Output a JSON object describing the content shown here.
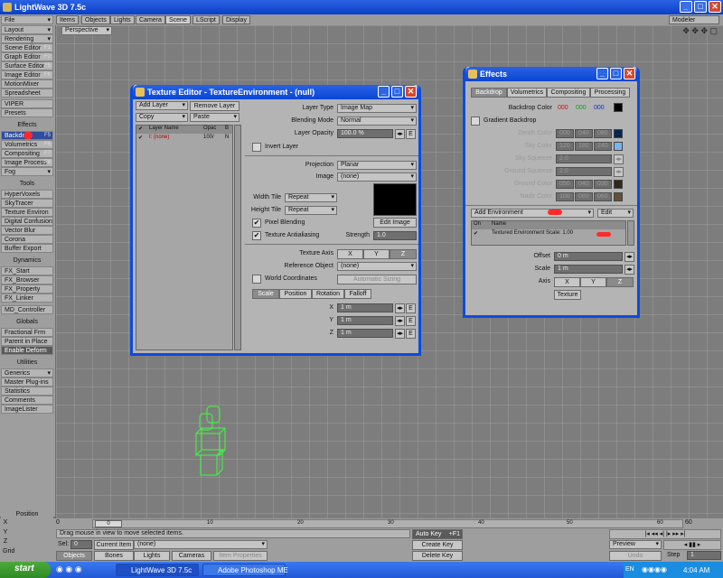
{
  "app": {
    "title": "LightWave 3D 7.5c"
  },
  "top_tabs": [
    "Items",
    "Objects",
    "Lights",
    "Camera",
    "Scene",
    "LScript",
    "Display"
  ],
  "modeler_label": "Modeler",
  "view_mode": "Perspective",
  "sidebar": {
    "file": "File",
    "layout": "Layout",
    "rendering": "Rendering",
    "scene_editor": "Scene Editor",
    "scene_editor_key": "F1",
    "graph_editor": "Graph Editor",
    "graph_editor_key": "F2",
    "surface_editor": "Surface Editor",
    "surface_editor_key": "F5",
    "image_editor": "Image Editor",
    "image_editor_key": "F6",
    "motion_mixer": "MotionMixer",
    "spreadsheet": "Spreadsheet",
    "viper": "VIPER",
    "presets": "Presets",
    "effects_header": "Effects",
    "backdrop": "Backdrop",
    "backdrop_key": "F5",
    "volumetrics": "Volumetrics",
    "volumetrics_key": "F6",
    "compositing": "Compositing",
    "compositing_key": "F7",
    "image_process": "Image Process",
    "image_process_key": "F8",
    "fog": "Fog",
    "tools_header": "Tools",
    "tools": [
      "HyperVoxels",
      "SkyTracer",
      "Texture Environ",
      "Digital Confusion",
      "Vector Blur",
      "Corona",
      "Buffer Export"
    ],
    "dynamics_header": "Dynamics",
    "dynamics": [
      "FX_Start",
      "FX_Browser",
      "FX_Property",
      "FX_Linker"
    ],
    "md_controller": "MD_Controller",
    "globals_header": "Globals",
    "globals": [
      "Fractional Frm",
      "Parent in Place",
      "Enable Deform"
    ],
    "utilities_header": "Utilities",
    "generics": "Generics",
    "master_plugins": "Master Plug-ins",
    "statistics": "Statistics",
    "comments": "Comments",
    "imagelister": "ImageLister",
    "position": "Position"
  },
  "texture_editor": {
    "title": "Texture Editor - TextureEnvironment - (null)",
    "add_layer": "Add Layer",
    "remove_layer": "Remove Layer",
    "copy": "Copy",
    "paste": "Paste",
    "cols": {
      "layer_name": "Layer Name",
      "opac": "Opac",
      "b": "B"
    },
    "row": {
      "name": "I: (none)",
      "opac": "100/",
      "b": "N"
    },
    "layer_type_label": "Layer Type",
    "layer_type": "Image Map",
    "blending_mode_label": "Blending Mode",
    "blending_mode": "Normal",
    "layer_opacity_label": "Layer Opacity",
    "layer_opacity": "100.0 %",
    "invert_layer": "Invert Layer",
    "projection_label": "Projection",
    "projection": "Planar",
    "image_label": "Image",
    "image": "(none)",
    "width_tile_label": "Width Tile",
    "width_tile": "Repeat",
    "height_tile_label": "Height Tile",
    "height_tile": "Repeat",
    "pixel_blending": "Pixel Blending",
    "edit_image": "Edit Image",
    "texture_antialiasing": "Texture Antialiasing",
    "strength_label": "Strength",
    "strength": "1.0",
    "texture_axis_label": "Texture Axis",
    "axis_x": "X",
    "axis_y": "Y",
    "axis_z": "Z",
    "reference_object_label": "Reference Object",
    "reference_object": "(none)",
    "world_coordinates": "World Coordinates",
    "automatic_sizing": "Automatic Sizing",
    "tabs": [
      "Scale",
      "Position",
      "Rotation",
      "Falloff"
    ],
    "x_label": "X",
    "x": "1 m",
    "y_label": "Y",
    "y": "1 m",
    "z_label": "Z",
    "z": "1 m",
    "e": "E"
  },
  "effects": {
    "title": "Effects",
    "tabs": [
      "Backdrop",
      "Volumetrics",
      "Compositing",
      "Processing"
    ],
    "backdrop_color_label": "Backdrop Color",
    "bc_r": "000",
    "bc_g": "000",
    "bc_b": "000",
    "gradient_backdrop": "Gradient Backdrop",
    "zenith_label": "Zenith Color",
    "zenith": [
      "000",
      "040",
      "080"
    ],
    "sky_label": "Sky Color",
    "sky": [
      "120",
      "180",
      "240"
    ],
    "sky_squeeze_label": "Sky Squeeze",
    "sky_squeeze": "2.0",
    "ground_squeeze_label": "Ground Squeeze",
    "ground_squeeze": "2.0",
    "ground_label": "Ground Color",
    "ground": [
      "050",
      "040",
      "030"
    ],
    "nadir_label": "Nadir Color",
    "nadir": [
      "100",
      "080",
      "060"
    ],
    "add_environment": "Add Environment",
    "edit": "Edit",
    "col_on": "On",
    "col_name": "Name",
    "env_item": "Textured Environment Scale: 1.00",
    "offset_label": "Offset",
    "offset": "0 m",
    "scale_label": "Scale",
    "scale": "1 m",
    "axis_label": "Axis",
    "axis_x": "X",
    "axis_y": "Y",
    "axis_z": "Z",
    "texture": "Texture",
    "colors": {
      "backdrop": "#000000",
      "zenith": "#002850",
      "sky": "#78b4f0",
      "ground": "#322818",
      "nadir": "#645038"
    }
  },
  "timeline": {
    "start": "0",
    "ticks": [
      "0",
      "10",
      "20",
      "30",
      "40",
      "50",
      "60"
    ],
    "end": "60",
    "x": "X",
    "y": "Y",
    "z": "Z",
    "grid": "Grid"
  },
  "status": {
    "message": "Drag mouse in view to move selected items.",
    "sel_label": "Sel:",
    "sel": "0",
    "current_item_label": "Current Item",
    "current_item": "(none)",
    "objects": "Objects",
    "bones": "Bones",
    "lights": "Lights",
    "cameras": "Cameras",
    "item_properties": "Item Properties",
    "auto_key": "Auto Key",
    "auto_key_hint": "+F1",
    "create_key": "Create Key",
    "delete_key": "Delete Key",
    "preview": "Preview",
    "undo": "Undo",
    "step_label": "Step",
    "step": "1"
  },
  "taskbar": {
    "start": "start",
    "tasks": [
      "LightWave 3D 7.5c",
      "Adobe Photoshop ME"
    ],
    "lang": "EN",
    "time": "4:04 AM"
  }
}
